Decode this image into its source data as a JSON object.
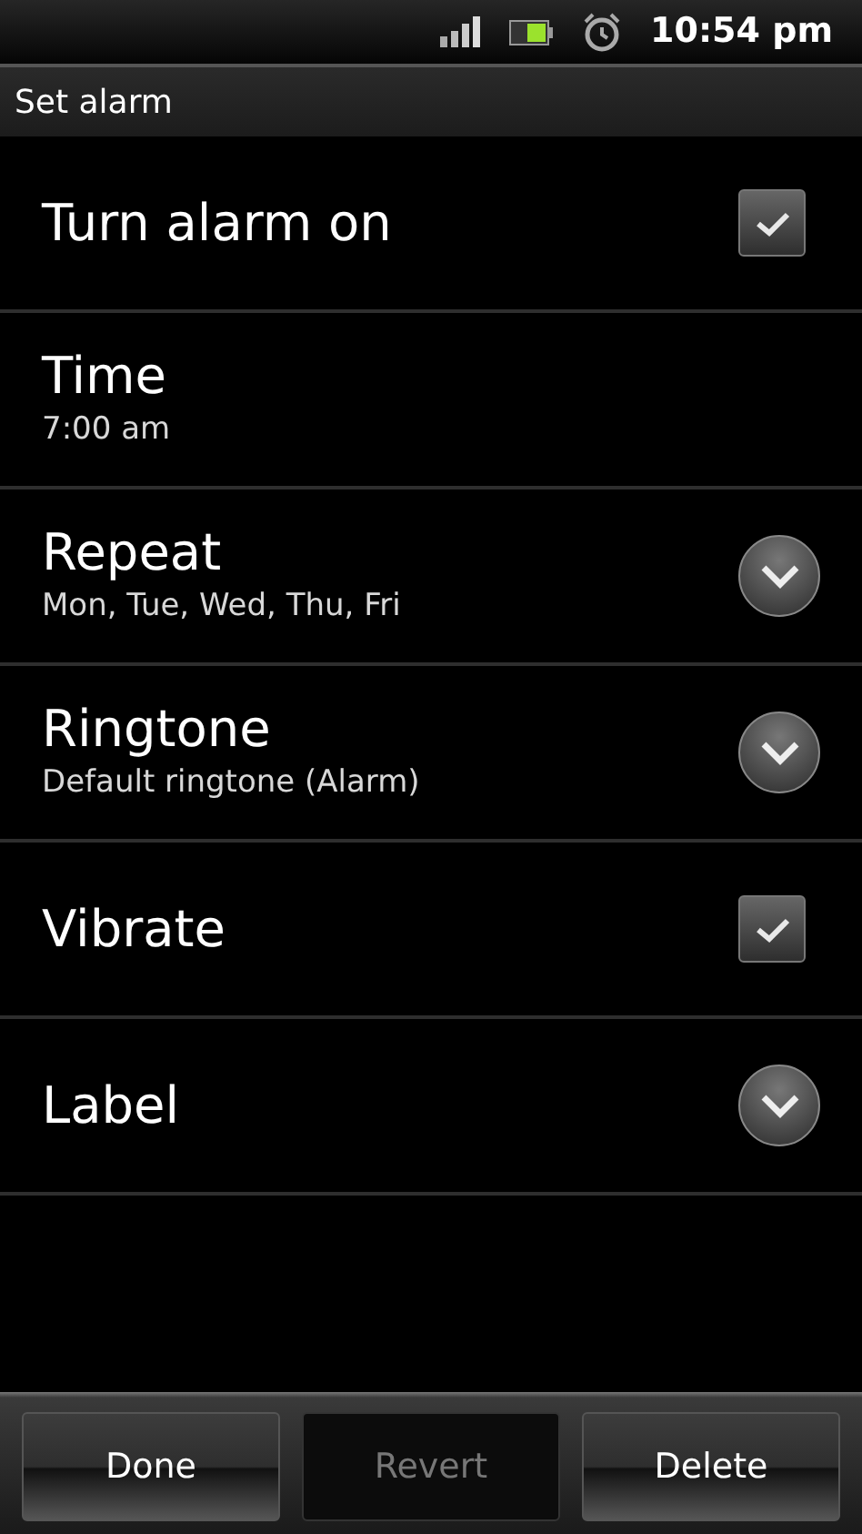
{
  "status_bar": {
    "time": "10:54 pm"
  },
  "title_bar": {
    "title": "Set alarm"
  },
  "settings": [
    {
      "kind": "checkbox",
      "title": "Turn alarm on",
      "checked": true
    },
    {
      "kind": "plain",
      "title": "Time",
      "summary": "7:00 am"
    },
    {
      "kind": "dropdown",
      "title": "Repeat",
      "summary": "Mon, Tue, Wed, Thu, Fri"
    },
    {
      "kind": "dropdown",
      "title": "Ringtone",
      "summary": "Default ringtone (Alarm)"
    },
    {
      "kind": "checkbox",
      "title": "Vibrate",
      "checked": true
    },
    {
      "kind": "dropdown",
      "title": "Label"
    }
  ],
  "buttons": [
    {
      "label": "Done",
      "disabled": false
    },
    {
      "label": "Revert",
      "disabled": true
    },
    {
      "label": "Delete",
      "disabled": false
    }
  ]
}
